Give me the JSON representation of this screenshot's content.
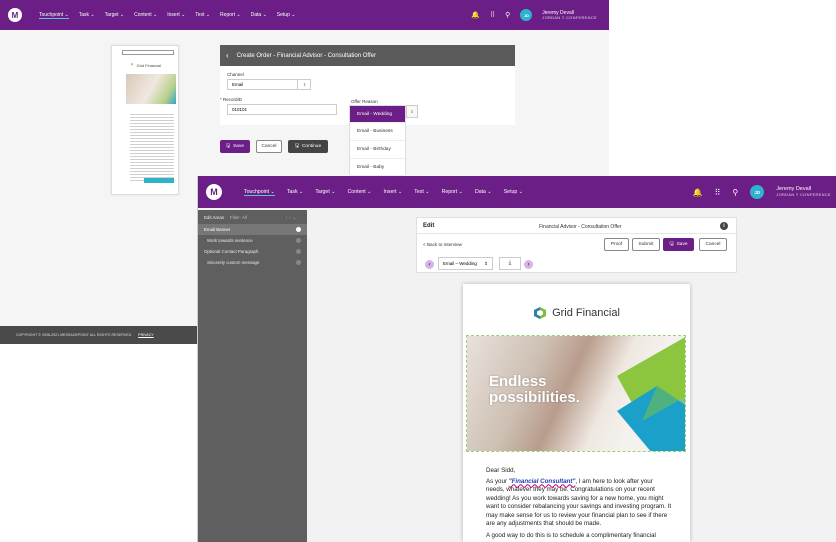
{
  "nav": {
    "logo": "M",
    "items": [
      "Touchpoint ⌄",
      "Task ⌄",
      "Target ⌄",
      "Content ⌄",
      "Insert ⌄",
      "Text ⌄",
      "Report ⌄",
      "Data ⌄",
      "Setup ⌄"
    ],
    "user_initials": "JD",
    "user_name": "Jeremy Devall",
    "user_org": "JORDAN ≡ CONFERENCE"
  },
  "order": {
    "title": "Create Order - Financial Advisor - Consultation Offer",
    "channel_label": "Channel",
    "channel_value": "Email",
    "record_label": "RecordID",
    "record_value": "010101",
    "offer_label": "Offer Reason",
    "offer_options": [
      "Email - Wedding",
      "Email - Business",
      "Email - Birthday",
      "Email - Baby"
    ],
    "save": "Save",
    "cancel": "Cancel",
    "continue": "Continue"
  },
  "thumb": {
    "brand": "Grid Financial"
  },
  "footer": {
    "copyright": "COPYRIGHT © 2006-2021 MESSAGEPOINT ALL RIGHTS RESERVED.",
    "privacy": "PRIVACY"
  },
  "editor": {
    "sidebar_header": "Edit Areas",
    "filter_label": "Filter: All",
    "areas": [
      {
        "label": "Email Banner",
        "required": false
      },
      {
        "label": "Work towards sentence",
        "required": true
      },
      {
        "label": "Optional Contact Paragraph",
        "required": false
      },
      {
        "label": "Sincerely custom message",
        "required": true
      }
    ],
    "edit_label": "Edit",
    "doc_title": "Financial Advisor - Consultation Offer",
    "back_link": "< Back to Interview",
    "proof": "Proof",
    "submit": "Submit",
    "save": "Save",
    "cancel": "Cancel",
    "variant": "Email – Wedding",
    "brand": "Grid Financial",
    "banner_line1": "Endless",
    "banner_line2": "possibilities.",
    "greeting": "Dear Sidd,",
    "para1_a": "As your ",
    "para1_link": "\"Financial Consultant\"",
    "para1_b": ", I am here to look after your needs, whatever they may be. Congratulations on your recent wedding! As you work towards saving for a new home, you might want to consider rebalancing your savings and investing program. It may make sense for us to review your financial plan to see if there are any adjustments that should be made.",
    "para2": "A good way to do this is to schedule a complimentary financial"
  },
  "colors": {
    "brand_purple": "#6b1e86",
    "accent_teal": "#58c6d8",
    "brand_green": "#7bbf3a"
  }
}
